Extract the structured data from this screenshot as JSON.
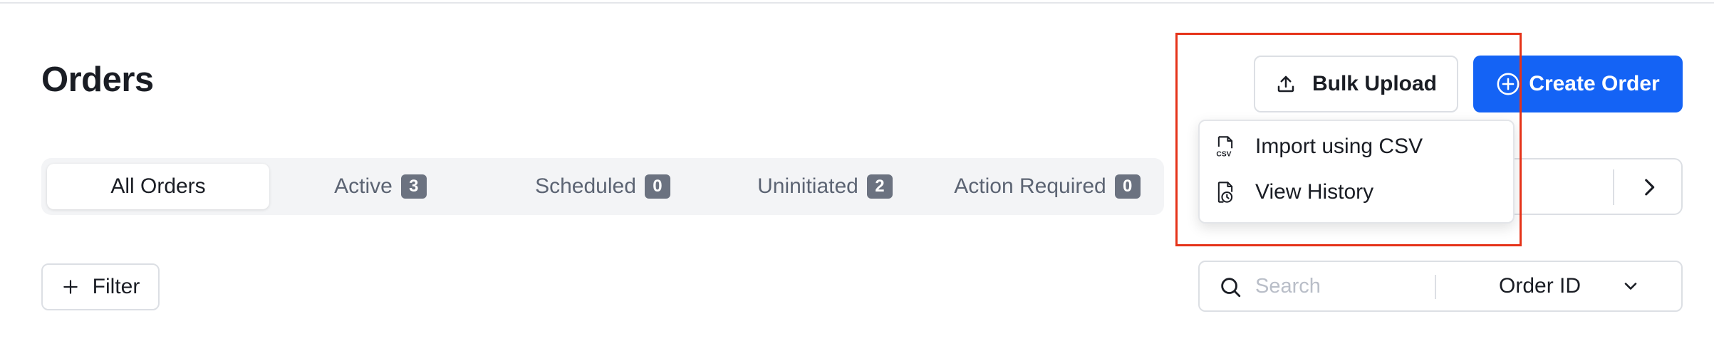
{
  "page": {
    "title": "Orders"
  },
  "header": {
    "bulk_upload_label": "Bulk Upload",
    "bulk_upload_icon": "upload-icon",
    "create_order_label": "Create Order",
    "create_order_icon": "plus-circle-icon"
  },
  "tabs": [
    {
      "label": "All Orders",
      "count": null,
      "active": true
    },
    {
      "label": "Active",
      "count": "3",
      "active": false
    },
    {
      "label": "Scheduled",
      "count": "0",
      "active": false
    },
    {
      "label": "Uninitiated",
      "count": "2",
      "active": false
    },
    {
      "label": "Action Required",
      "count": "0",
      "active": false
    }
  ],
  "bulk_upload_menu": {
    "items": [
      {
        "label": "Import using CSV",
        "icon": "csv-file-icon"
      },
      {
        "label": "View History",
        "icon": "file-history-icon"
      }
    ]
  },
  "filter": {
    "label": "Filter",
    "icon": "plus-icon"
  },
  "search": {
    "placeholder": "Search",
    "value": "",
    "field_selected": "Order ID"
  },
  "colors": {
    "primary": "#1463f5",
    "highlight": "#e53319",
    "badge": "#6b7280"
  }
}
